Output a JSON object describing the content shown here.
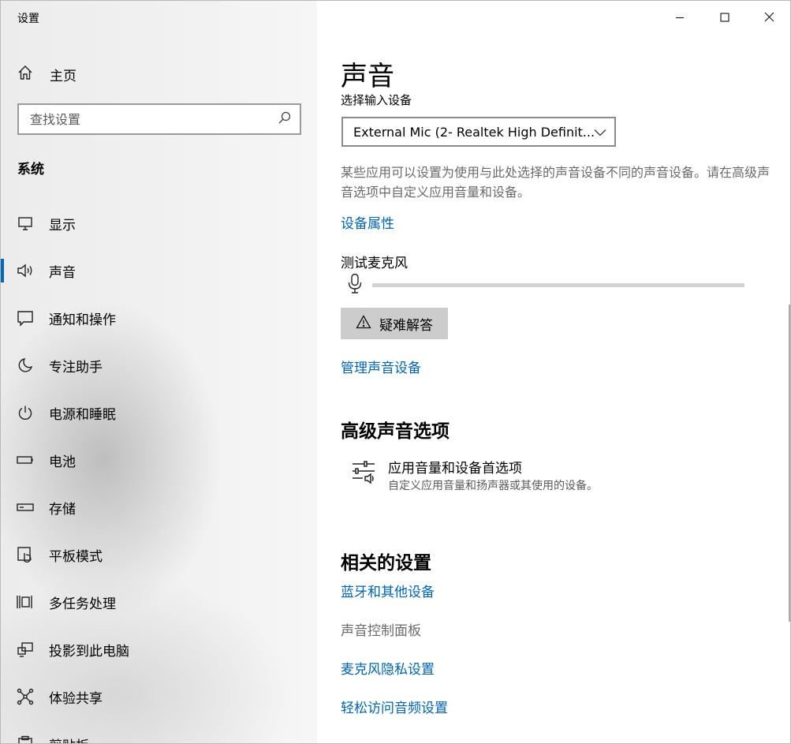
{
  "window": {
    "title": "设置"
  },
  "sidebar": {
    "home_label": "主页",
    "search_placeholder": "查找设置",
    "section_title": "系统",
    "items": [
      {
        "label": "显示",
        "icon": "display-icon"
      },
      {
        "label": "声音",
        "icon": "speaker-icon",
        "active": true
      },
      {
        "label": "通知和操作",
        "icon": "notification-icon"
      },
      {
        "label": "专注助手",
        "icon": "moon-icon"
      },
      {
        "label": "电源和睡眠",
        "icon": "power-icon"
      },
      {
        "label": "电池",
        "icon": "battery-icon"
      },
      {
        "label": "存储",
        "icon": "storage-icon"
      },
      {
        "label": "平板模式",
        "icon": "tablet-icon"
      },
      {
        "label": "多任务处理",
        "icon": "multitask-icon"
      },
      {
        "label": "投影到此电脑",
        "icon": "project-icon"
      },
      {
        "label": "体验共享",
        "icon": "share-icon"
      },
      {
        "label": "剪贴板",
        "icon": "clipboard-icon"
      }
    ]
  },
  "main": {
    "title": "声音",
    "input_device_label": "选择输入设备",
    "input_device_value": "External Mic (2- Realtek High Definit...",
    "description": "某些应用可以设置为使用与此处选择的声音设备不同的声音设备。请在高级声音选项中自定义应用音量和设备。",
    "device_properties_link": "设备属性",
    "test_mic_label": "测试麦克风",
    "mic_level": 0,
    "troubleshoot_label": "疑难解答",
    "manage_devices_link": "管理声音设备",
    "advanced": {
      "heading": "高级声音选项",
      "item_title": "应用音量和设备首选项",
      "item_desc": "自定义应用音量和扬声器或其使用的设备。"
    },
    "related": {
      "heading": "相关的设置",
      "links": [
        "蓝牙和其他设备",
        "声音控制面板",
        "麦克风隐私设置",
        "轻松访问音频设置"
      ]
    }
  },
  "colors": {
    "accent": "#0067c0",
    "link": "#0063b1"
  }
}
